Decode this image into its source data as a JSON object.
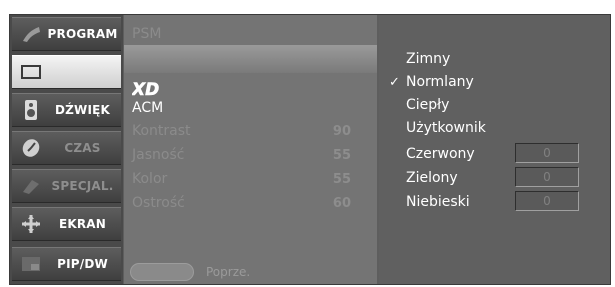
{
  "categories": [
    {
      "label": "PROGRAM",
      "icon": "program-icon",
      "active": false,
      "dim": false
    },
    {
      "label": "",
      "icon": "picture-icon",
      "active": true,
      "dim": false
    },
    {
      "label": "DŹWIĘK",
      "icon": "speaker-icon",
      "active": false,
      "dim": false
    },
    {
      "label": "CZAS",
      "icon": "clock-icon",
      "active": false,
      "dim": true
    },
    {
      "label": "SPECJAL.",
      "icon": "special-icon",
      "active": false,
      "dim": true
    },
    {
      "label": "EKRAN",
      "icon": "screen-icon",
      "active": false,
      "dim": false
    },
    {
      "label": "PIP/DW",
      "icon": "pip-icon",
      "active": false,
      "dim": false
    }
  ],
  "submenu": {
    "psm_label": "PSM",
    "xd_logo": "XD",
    "acm_label": "ACM",
    "items": [
      {
        "label": "Kontrast",
        "value": "90"
      },
      {
        "label": "Jasność",
        "value": "55"
      },
      {
        "label": "Kolor",
        "value": "55"
      },
      {
        "label": "Ostrość",
        "value": "60"
      }
    ],
    "prev_label": "Poprze."
  },
  "options": {
    "check_mark": "✓",
    "items": [
      {
        "label": "Zimny",
        "checked": false
      },
      {
        "label": "Normlany",
        "checked": true
      },
      {
        "label": "Ciepły",
        "checked": false
      },
      {
        "label": "Użytkownik",
        "checked": false
      }
    ],
    "rgb": [
      {
        "label": "Czerwony",
        "value": "0"
      },
      {
        "label": "Zielony",
        "value": "0"
      },
      {
        "label": "Niebieski",
        "value": "0"
      }
    ]
  },
  "colors": {
    "osd_background": "#5e5e5e",
    "active_tab": "#e6e6e6",
    "text": "#ffffff",
    "dim_text": "#8b8b8b"
  }
}
